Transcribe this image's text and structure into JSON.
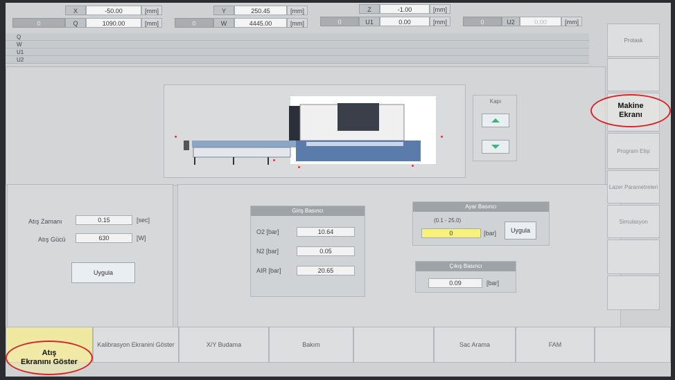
{
  "axes": {
    "x": {
      "label": "X",
      "value": "-50.00",
      "unit": "[mm]"
    },
    "y": {
      "label": "Y",
      "value": "250.45",
      "unit": "[mm]"
    },
    "z": {
      "label": "Z",
      "value": "-1.00",
      "unit": "[mm]"
    },
    "q": {
      "pre": "0",
      "label": "Q",
      "value": "1090.00",
      "unit": "[mm]"
    },
    "w": {
      "pre": "0",
      "label": "W",
      "value": "4445.00",
      "unit": "[mm]"
    },
    "u1": {
      "pre": "0",
      "label": "U1",
      "value": "0.00",
      "unit": "[mm]"
    },
    "u2": {
      "pre": "0",
      "label": "U2",
      "value": "0.00",
      "unit": "[mm]"
    }
  },
  "tracks": [
    "Q",
    "W",
    "U1",
    "U2"
  ],
  "door": {
    "title": "Kapı"
  },
  "laser": {
    "time_label": "Atış Zamanı",
    "time_value": "0.15",
    "time_unit": "[sec]",
    "power_label": "Atış Gücü",
    "power_value": "630",
    "power_unit": "[W]",
    "apply": "Uygula"
  },
  "gas": {
    "title": "Giriş Basıncı",
    "rows": [
      {
        "label": "O2 [bar]",
        "value": "10.64"
      },
      {
        "label": "N2 [bar]",
        "value": "0.05"
      },
      {
        "label": "AIR [bar]",
        "value": "20.65"
      }
    ]
  },
  "setpress": {
    "title": "Ayar Basıncı",
    "range": "(0.1 - 25.0)",
    "value": "0",
    "unit": "[bar]",
    "apply": "Uygula"
  },
  "outpress": {
    "title": "Çıkış Basıncı",
    "value": "0.09",
    "unit": "[bar]"
  },
  "right_menu": [
    "Protask",
    "",
    "",
    "Program Elişi",
    "Lazer Parametreleri",
    "Simulasyon",
    "",
    ""
  ],
  "bottom_tabs": [
    "",
    "Kalibrasyon Ekranini Göster",
    "X/Y Budama",
    "Bakım",
    "",
    "Sac Arama",
    "FAM",
    ""
  ],
  "callouts": {
    "machine": "Makine\nEkranı",
    "fire": "Atış\nEkranını Göster"
  }
}
